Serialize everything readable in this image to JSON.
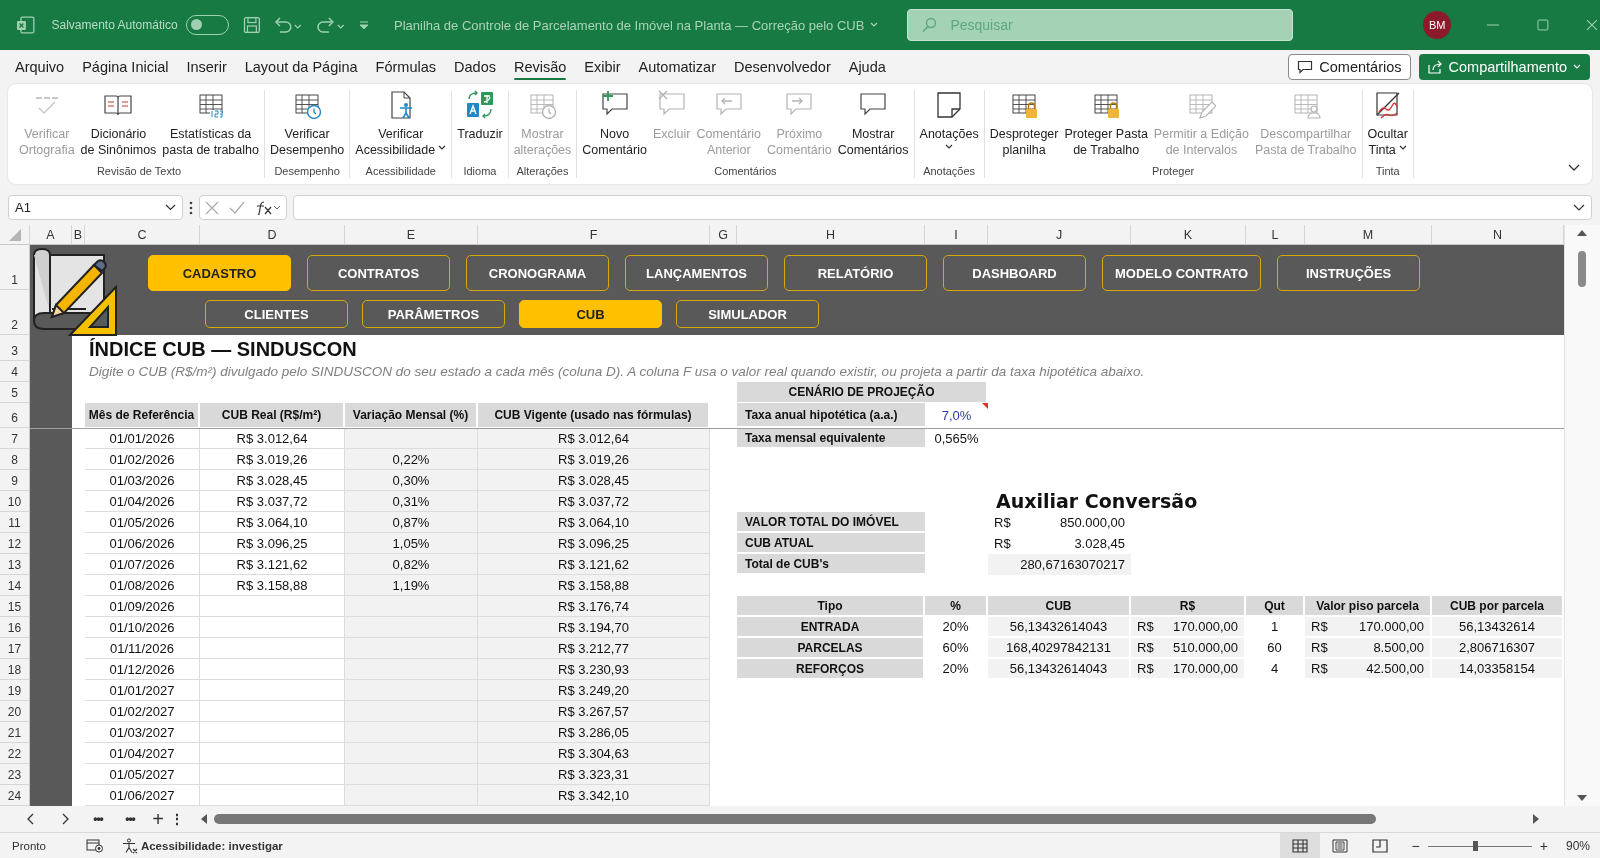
{
  "title_bar": {
    "autosave_label": "Salvamento Automático",
    "autosave_on": false,
    "title": "Planilha de Controle de Parcelamento de Imóvel na Planta — Correção pelo CUB",
    "search": {
      "placeholder": "Pesquisar"
    },
    "avatar": "BM"
  },
  "menu": {
    "tabs": [
      {
        "label": "Arquivo",
        "selected": false
      },
      {
        "label": "Página Inicial",
        "selected": false
      },
      {
        "label": "Inserir",
        "selected": false
      },
      {
        "label": "Layout da Página",
        "selected": false
      },
      {
        "label": "Fórmulas",
        "selected": false
      },
      {
        "label": "Dados",
        "selected": false
      },
      {
        "label": "Revisão",
        "selected": true
      },
      {
        "label": "Exibir",
        "selected": false
      },
      {
        "label": "Automatizar",
        "selected": false
      },
      {
        "label": "Desenvolvedor",
        "selected": false
      },
      {
        "label": "Ajuda",
        "selected": false
      }
    ],
    "comments_button": "Comentários",
    "share_button": "Compartilhamento"
  },
  "ribbon": {
    "groups": [
      {
        "label": "Revisão de Texto",
        "buttons": [
          {
            "lines": [
              "Verificar",
              "Ortografia"
            ],
            "disabled": true,
            "dropdown": false
          },
          {
            "lines": [
              "Dicionário",
              "de Sinônimos"
            ],
            "disabled": false,
            "dropdown": false
          },
          {
            "lines": [
              "Estatísticas da",
              "pasta de trabalho"
            ],
            "disabled": false,
            "dropdown": false
          }
        ]
      },
      {
        "label": "Desempenho",
        "buttons": [
          {
            "lines": [
              "Verificar",
              "Desempenho"
            ],
            "disabled": false,
            "dropdown": false
          }
        ]
      },
      {
        "label": "Acessibilidade",
        "buttons": [
          {
            "lines": [
              "Verificar",
              "Acessibilidade"
            ],
            "disabled": false,
            "dropdown": true
          }
        ]
      },
      {
        "label": "Idioma",
        "buttons": [
          {
            "lines": [
              "Traduzir"
            ],
            "disabled": false,
            "dropdown": false
          }
        ]
      },
      {
        "label": "Alterações",
        "buttons": [
          {
            "lines": [
              "Mostrar",
              "alterações"
            ],
            "disabled": true,
            "dropdown": false
          }
        ]
      },
      {
        "label": "Comentários",
        "buttons": [
          {
            "lines": [
              "Novo",
              "Comentário"
            ],
            "disabled": false,
            "dropdown": false
          },
          {
            "lines": [
              "Excluir"
            ],
            "disabled": true,
            "dropdown": false
          },
          {
            "lines": [
              "Comentário",
              "Anterior"
            ],
            "disabled": true,
            "dropdown": false
          },
          {
            "lines": [
              "Próximo",
              "Comentário"
            ],
            "disabled": true,
            "dropdown": false
          },
          {
            "lines": [
              "Mostrar",
              "Comentários"
            ],
            "disabled": false,
            "dropdown": false
          }
        ]
      },
      {
        "label": "Anotações",
        "buttons": [
          {
            "lines": [
              "Anotações"
            ],
            "disabled": false,
            "dropdown": true
          }
        ]
      },
      {
        "label": "Proteger",
        "buttons": [
          {
            "lines": [
              "Desproteger",
              "planilha"
            ],
            "disabled": false,
            "dropdown": false
          },
          {
            "lines": [
              "Proteger Pasta",
              "de Trabalho"
            ],
            "disabled": false,
            "dropdown": false
          },
          {
            "lines": [
              "Permitir a Edição",
              "de Intervalos"
            ],
            "disabled": true,
            "dropdown": false
          },
          {
            "lines": [
              "Descompartilhar",
              "Pasta de Trabalho"
            ],
            "disabled": true,
            "dropdown": false
          }
        ]
      },
      {
        "label": "Tinta",
        "buttons": [
          {
            "lines": [
              "Ocultar",
              "Tinta"
            ],
            "disabled": false,
            "dropdown": true
          }
        ]
      }
    ]
  },
  "formula_bar": {
    "name_box": "A1"
  },
  "sheet": {
    "columns": [
      "A",
      "B",
      "C",
      "D",
      "E",
      "F",
      "G",
      "H",
      "I",
      "J",
      "K",
      "L",
      "M",
      "N"
    ],
    "rows": [
      "1",
      "2",
      "3",
      "4",
      "5",
      "6",
      "7",
      "8",
      "9",
      "10",
      "11",
      "12",
      "13",
      "14",
      "15",
      "16",
      "17",
      "18",
      "19",
      "20",
      "21",
      "22",
      "23",
      "24"
    ],
    "nav_rows": [
      [
        {
          "label": "CADASTRO",
          "selected": true
        },
        {
          "label": "CONTRATOS",
          "selected": false
        },
        {
          "label": "CRONOGRAMA",
          "selected": false
        },
        {
          "label": "LANÇAMENTOS",
          "selected": false
        },
        {
          "label": "RELATÓRIO",
          "selected": false
        },
        {
          "label": "DASHBOARD",
          "selected": false
        },
        {
          "label": "MODELO CONTRATO",
          "selected": false
        },
        {
          "label": "INSTRUÇÕES",
          "selected": false
        }
      ],
      [
        {
          "label": "CLIENTES",
          "selected": false
        },
        {
          "label": "PARÂMETROS",
          "selected": false
        },
        {
          "label": "CUB",
          "selected": true
        },
        {
          "label": "SIMULADOR",
          "selected": false
        }
      ]
    ],
    "title": "ÍNDICE CUB — SINDUSCON",
    "subtitle": "Digite o CUB (R$/m²) divulgado pelo SINDUSCON do seu estado a cada mês (coluna D). A coluna F usa o valor real quando existir, ou projeta a partir da taxa hipotética abaixo.",
    "cub_table": {
      "columns": [
        "Mês de Referência",
        "CUB Real (R$/m²)",
        "Variação Mensal (%)",
        "CUB Vigente (usado nas fórmulas)"
      ],
      "rows": [
        {
          "month": "01/01/2026",
          "cub_real": "R$ 3.012,64",
          "cub_vigente": "R$ 3.012,64"
        },
        {
          "month": "01/02/2026",
          "cub_real": "R$ 3.019,26",
          "variation": "0,22%",
          "cub_vigente": "R$ 3.019,26"
        },
        {
          "month": "01/03/2026",
          "cub_real": "R$ 3.028,45",
          "variation": "0,30%",
          "cub_vigente": "R$ 3.028,45"
        },
        {
          "month": "01/04/2026",
          "cub_real": "R$ 3.037,72",
          "variation": "0,31%",
          "cub_vigente": "R$ 3.037,72"
        },
        {
          "month": "01/05/2026",
          "cub_real": "R$ 3.064,10",
          "variation": "0,87%",
          "cub_vigente": "R$ 3.064,10"
        },
        {
          "month": "01/06/2026",
          "cub_real": "R$ 3.096,25",
          "variation": "1,05%",
          "cub_vigente": "R$ 3.096,25"
        },
        {
          "month": "01/07/2026",
          "cub_real": "R$ 3.121,62",
          "variation": "0,82%",
          "cub_vigente": "R$ 3.121,62"
        },
        {
          "month": "01/08/2026",
          "cub_real": "R$ 3.158,88",
          "variation": "1,19%",
          "cub_vigente": "R$ 3.158,88"
        },
        {
          "month": "01/09/2026",
          "cub_vigente": "R$ 3.176,74"
        },
        {
          "month": "01/10/2026",
          "cub_vigente": "R$ 3.194,70"
        },
        {
          "month": "01/11/2026",
          "cub_vigente": "R$ 3.212,77"
        },
        {
          "month": "01/12/2026",
          "cub_vigente": "R$ 3.230,93"
        },
        {
          "month": "01/01/2027",
          "cub_vigente": "R$ 3.249,20"
        },
        {
          "month": "01/02/2027",
          "cub_vigente": "R$ 3.267,57"
        },
        {
          "month": "01/03/2027",
          "cub_vigente": "R$ 3.286,05"
        },
        {
          "month": "01/04/2027",
          "cub_vigente": "R$ 3.304,63"
        },
        {
          "month": "01/05/2027",
          "cub_vigente": "R$ 3.323,31"
        },
        {
          "month": "01/06/2027",
          "cub_vigente": "R$ 3.342,10"
        }
      ]
    },
    "projection": {
      "title": "CENÁRIO DE PROJEÇÃO",
      "rows": [
        {
          "label": "Taxa anual hipotética (a.a.)",
          "value": "7,0%",
          "kind": "input",
          "has_comment": true
        },
        {
          "label": "Taxa mensal equivalente",
          "value": "0,565%",
          "kind": "formula"
        }
      ]
    },
    "conversion": {
      "title": "Auxiliar Conversão",
      "rows": [
        {
          "label": "VALOR TOTAL DO IMÓVEL",
          "currency": "R$",
          "value": "850.000,00",
          "shaded": false
        },
        {
          "label": "CUB ATUAL",
          "currency": "R$",
          "value": "3.028,45",
          "shaded": false
        },
        {
          "label": "Total de CUB's",
          "value": "280,67163070217",
          "shaded": true
        }
      ]
    },
    "types_table": {
      "columns": [
        "Tipo",
        "%",
        "CUB",
        "R$",
        "Qut",
        "Valor piso parcela",
        "CUB por parcela"
      ],
      "rows": [
        {
          "type": "ENTRADA",
          "percent": "20%",
          "cub": "56,13432614043",
          "currency": "R$",
          "amount": "170.000,00",
          "quantity": "1",
          "floor_currency": "R$",
          "floor_value": "170.000,00",
          "cub_per_installment": "56,13432614"
        },
        {
          "type": "PARCELAS",
          "percent": "60%",
          "cub": "168,40297842131",
          "currency": "R$",
          "amount": "510.000,00",
          "quantity": "60",
          "floor_currency": "R$",
          "floor_value": "8.500,00",
          "cub_per_installment": "2,806716307"
        },
        {
          "type": "REFORÇOS",
          "percent": "20%",
          "cub": "56,13432614043",
          "currency": "R$",
          "amount": "170.000,00",
          "quantity": "4",
          "floor_currency": "R$",
          "floor_value": "42.500,00",
          "cub_per_installment": "14,03358154"
        }
      ]
    }
  },
  "sheet_bar": {
    "more_left": "•••",
    "more_right": "•••",
    "add": "+",
    "options": "⋮"
  },
  "status_bar": {
    "status": "Pronto",
    "accessibility": "Acessibilidade: investigar",
    "views": [
      {
        "selected": true
      },
      {
        "selected": false
      },
      {
        "selected": false
      }
    ],
    "zoom_out": "−",
    "zoom_in": "+",
    "zoom": {
      "level": 0.45,
      "reading": "90%"
    }
  }
}
